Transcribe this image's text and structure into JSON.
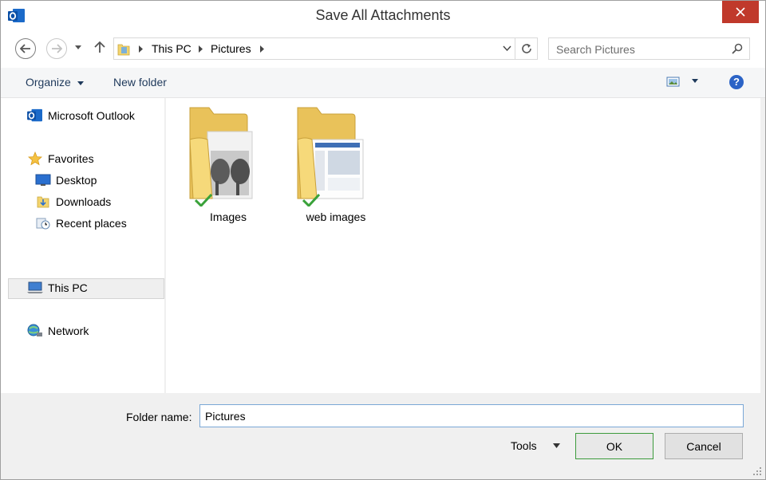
{
  "window": {
    "title": "Save All Attachments",
    "app_icon": "outlook-icon"
  },
  "address": {
    "crumbs": [
      "This PC",
      "Pictures"
    ],
    "search_placeholder": "Search Pictures"
  },
  "commandbar": {
    "organize_label": "Organize",
    "new_folder_label": "New folder"
  },
  "sidebar": {
    "items": [
      {
        "label": "Microsoft Outlook",
        "icon": "outlook-icon"
      },
      {
        "label": "Favorites",
        "icon": "star-icon"
      },
      {
        "label": "Desktop",
        "icon": "desktop-icon"
      },
      {
        "label": "Downloads",
        "icon": "downloads-icon"
      },
      {
        "label": "Recent places",
        "icon": "recent-places-icon"
      },
      {
        "label": "This PC",
        "icon": "computer-icon",
        "selected": true
      },
      {
        "label": "Network",
        "icon": "network-icon"
      }
    ]
  },
  "files": [
    {
      "name": "Images",
      "icon": "folder-icon",
      "synced": true
    },
    {
      "name": "web images",
      "icon": "folder-icon",
      "synced": true
    }
  ],
  "bottom": {
    "folder_name_label": "Folder name:",
    "folder_name_value": "Pictures",
    "tools_label": "Tools",
    "ok_label": "OK",
    "cancel_label": "Cancel"
  },
  "colors": {
    "close_button": "#c0392b",
    "accent_blue": "#1e395b",
    "ok_border": "#3c9b3c",
    "selection": "#efefef"
  }
}
